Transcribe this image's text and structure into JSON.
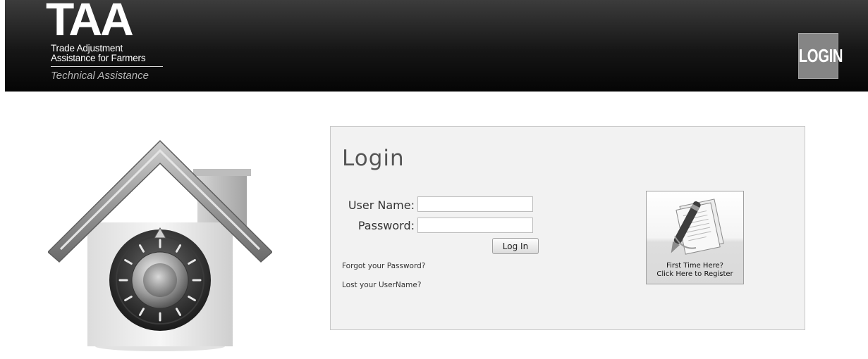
{
  "header": {
    "logo": {
      "acronym": "TAA",
      "line1": "Trade Adjustment",
      "line2": "Assistance for Farmers",
      "subtitle": "Technical Assistance"
    },
    "login_button": "LOGIN"
  },
  "hero": {
    "icon": "house-safe-icon"
  },
  "login_panel": {
    "title": "Login",
    "username_label": "User Name:",
    "username_value": "",
    "password_label": "Password:",
    "password_value": "",
    "submit_label": "Log In",
    "forgot_password": "Forgot your Password?",
    "lost_username": "Lost your UserName?"
  },
  "register": {
    "icon": "documents-pen-icon",
    "line1": "First Time Here?",
    "line2": "Click Here to Register"
  },
  "colors": {
    "header_bg": "#0e0e0e",
    "header_button": "#858585",
    "panel_bg": "#f2f2f2",
    "panel_border": "#c8c8c8"
  }
}
